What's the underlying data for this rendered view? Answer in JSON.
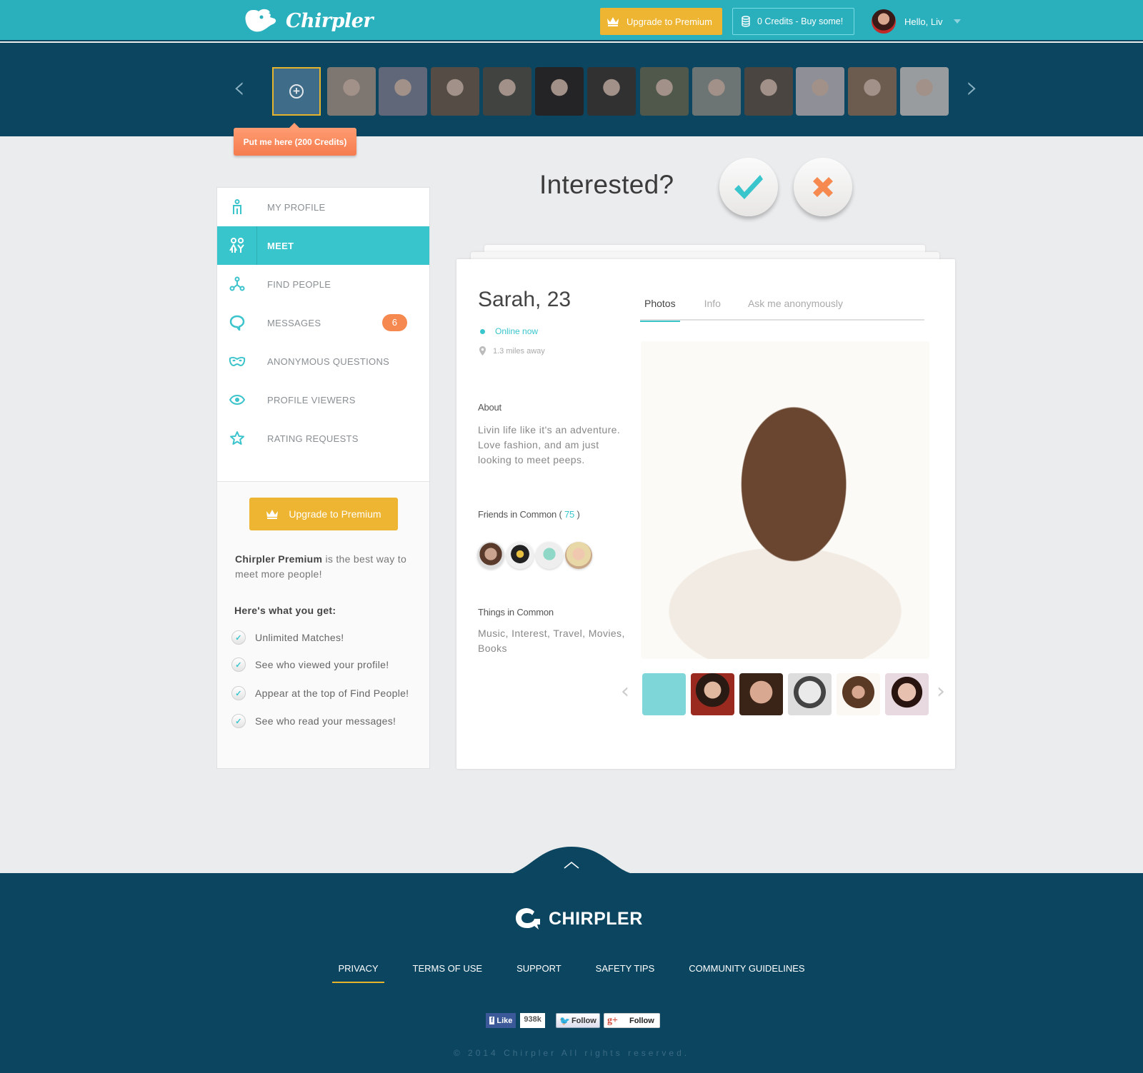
{
  "header": {
    "brand": "Chirpler",
    "upgrade_label": "Upgrade to Premium",
    "credits_label": "0 Credits - Buy some!",
    "greeting": "Hello, Liv"
  },
  "strip": {
    "tooltip": "Put me here (200 Credits)",
    "thumb_count": 13,
    "thumb_colors": [
      "#3f6c88",
      "#9a8a80",
      "#6b7a9c",
      "#6a5a4a",
      "#4a5048",
      "#2a2a30",
      "#3a3a3a",
      "#5a6a50",
      "#7a8a8a",
      "#5a5048",
      "#a8a8b8",
      "#8a6a50",
      "#b0b8bc"
    ]
  },
  "sidebar": {
    "items": [
      {
        "label": "MY PROFILE",
        "icon": "person-icon"
      },
      {
        "label": "MEET",
        "icon": "couple-icon",
        "active": true
      },
      {
        "label": "FIND PEOPLE",
        "icon": "network-icon"
      },
      {
        "label": "MESSAGES",
        "icon": "chat-bubble-icon",
        "badge": "6"
      },
      {
        "label": "ANONYMOUS QUESTIONS",
        "icon": "mask-icon"
      },
      {
        "label": "PROFILE VIEWERS",
        "icon": "eye-icon"
      },
      {
        "label": "RATING REQUESTS",
        "icon": "star-icon"
      }
    ],
    "upgrade_label": "Upgrade to Premium",
    "promo_bold": "Chirpler Premium",
    "promo_rest": " is the best way to meet more people!",
    "get_heading": "Here's  what you get:",
    "perks": [
      "Unlimited Matches!",
      "See who viewed your profile!",
      "Appear at the top of Find People!",
      "See who read your messages!"
    ]
  },
  "main": {
    "question": "Interested?",
    "profile": {
      "name": "Sarah, 23",
      "status": "Online now",
      "distance": "1.3 miles away",
      "about_heading": "About",
      "about_text": "Livin life like it's an adventure. Love fashion, and am just looking to meet peeps.",
      "friends_heading": "Friends in Common",
      "friends_count": "75",
      "things_heading": "Things in Common",
      "things_text": "Music, Interest, Travel, Movies, Books"
    },
    "tabs": [
      "Photos",
      "Info",
      "Ask me anonymously"
    ],
    "active_tab": "Photos"
  },
  "footer": {
    "brand": "CHIRPLER",
    "links": [
      "PRIVACY",
      "TERMS OF USE",
      "SUPPORT",
      "SAFETY TIPS",
      "COMMUNITY GUIDELINES"
    ],
    "active_link": "PRIVACY",
    "fb_like": "Like",
    "fb_count": "938k",
    "tw_follow": "Follow",
    "gp_follow": "Follow",
    "copyright": "© 2014 Chirpler All rights reserved."
  },
  "colors": {
    "accent": "#38c5cc",
    "brand_bar": "#2aafbd",
    "dark": "#0b4560",
    "gold": "#edb531",
    "orange": "#f5894f"
  }
}
